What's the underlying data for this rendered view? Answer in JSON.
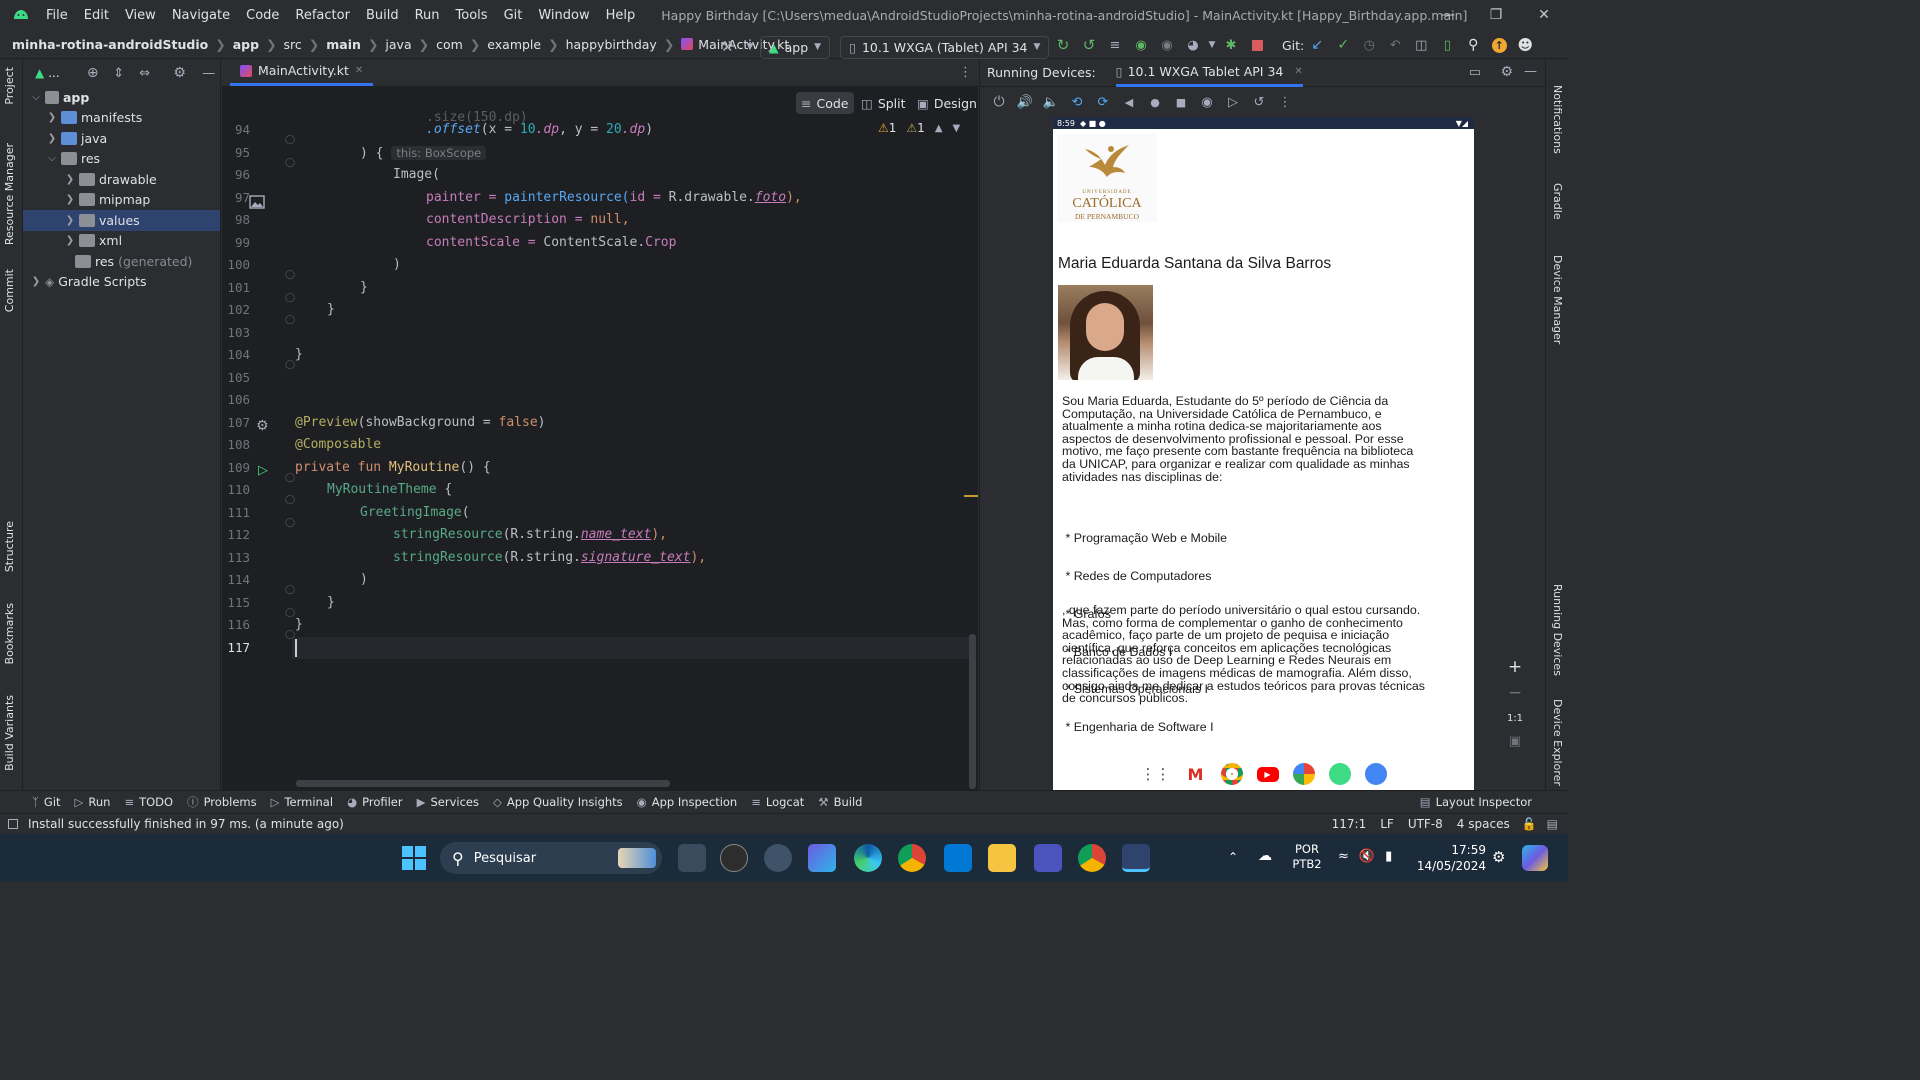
{
  "titlebar": {
    "menu": [
      "File",
      "Edit",
      "View",
      "Navigate",
      "Code",
      "Refactor",
      "Build",
      "Run",
      "Tools",
      "Git",
      "Window",
      "Help"
    ],
    "window_title": "Happy Birthday [C:\\Users\\medua\\AndroidStudioProjects\\minha-rotina-androidStudio] - MainActivity.kt [Happy_Birthday.app.main]"
  },
  "navbar": {
    "breadcrumbs": [
      "minha-rotina-androidStudio",
      "app",
      "src",
      "main",
      "java",
      "com",
      "example",
      "happybirthday",
      "MainActivity.kt"
    ],
    "run_config": "app",
    "device": "10.1  WXGA (Tablet) API 34",
    "git_label": "Git:"
  },
  "left_strip": {
    "labels": [
      "Project",
      "Resource Manager",
      "Commit",
      "Structure",
      "Bookmarks",
      "Build Variants"
    ]
  },
  "right_strip": {
    "labels": [
      "Notifications",
      "Gradle",
      "Device Manager",
      "Running Devices",
      "Device Explorer"
    ]
  },
  "project_tree": {
    "panel_label": "...",
    "items": [
      {
        "label": "app",
        "level": 0,
        "expanded": true
      },
      {
        "label": "manifests",
        "level": 1,
        "expanded": false
      },
      {
        "label": "java",
        "level": 1,
        "expanded": false
      },
      {
        "label": "res",
        "level": 1,
        "expanded": true
      },
      {
        "label": "drawable",
        "level": 2,
        "expanded": false
      },
      {
        "label": "mipmap",
        "level": 2,
        "expanded": false
      },
      {
        "label": "values",
        "level": 2,
        "expanded": false,
        "selected": true
      },
      {
        "label": "xml",
        "level": 2,
        "expanded": false
      },
      {
        "label": "res",
        "suffix": "(generated)",
        "level": 1
      },
      {
        "label": "Gradle Scripts",
        "level": 0,
        "expanded": false
      }
    ]
  },
  "editor": {
    "tab": "MainActivity.kt",
    "modes": [
      "Code",
      "Split",
      "Design"
    ],
    "warnings": [
      "1",
      "1"
    ],
    "line_numbers": [
      "94",
      "95",
      "96",
      "97",
      "98",
      "99",
      "100",
      "101",
      "102",
      "103",
      "104",
      "105",
      "106",
      "107",
      "108",
      "109",
      "110",
      "111",
      "112",
      "113",
      "114",
      "115",
      "116",
      "117"
    ],
    "inlay_hint": "this: BoxScope",
    "lines": {
      "l94_a": ".offset",
      "l94_b": "(x = ",
      "l94_c": "10",
      "l94_d": ".dp",
      "l94_e": ", y = ",
      "l94_f": "20",
      "l94_g": ".dp",
      "l94_h": ")",
      "l95": ") {",
      "l96": "Image(",
      "l97_a": "painter = ",
      "l97_b": "painterResource(",
      "l97_c": "id = ",
      "l97_d": "R.drawable.",
      "l97_e": "foto",
      "l97_f": "),",
      "l98_a": "contentDescription = ",
      "l98_b": "null",
      "l98_c": ",",
      "l99_a": "contentScale = ",
      "l99_b": "ContentScale.",
      "l99_c": "Crop",
      "l100": ")",
      "l101": "}",
      "l102": "}",
      "l104": "}",
      "l107_a": "@Preview",
      "l107_b": "(showBackground = ",
      "l107_c": "false",
      "l107_d": ")",
      "l108": "@Composable",
      "l109_a": "private fun ",
      "l109_b": "MyRoutine",
      "l109_c": "() {",
      "l110_a": "MyRoutineTheme",
      "l110_b": " {",
      "l111_a": "GreetingImage",
      "l111_b": "(",
      "l112_a": "stringResource",
      "l112_b": "(R.string.",
      "l112_c": "name_text",
      "l112_d": "),",
      "l113_a": "stringResource",
      "l113_b": "(R.string.",
      "l113_c": "signature_text",
      "l113_d": "),",
      "l114": ")",
      "l115": "}",
      "l116": "}"
    }
  },
  "running_devices": {
    "label": "Running Devices:",
    "tab": "10.1 WXGA Tablet API 34",
    "status_time": "8:59",
    "logo_lines": [
      "UNIVERSIDADE",
      "CATÓLICA",
      "DE PERNAMBUCO"
    ],
    "name": "Maria Eduarda Santana da Silva Barros",
    "bio_lines": [
      "Sou Maria Eduarda, Estudante do 5º período de Ciência da",
      "Computação, na Universidade Católica de Pernambuco, e",
      "atualmente a minha rotina dedica-se majoritariamente aos",
      "aspectos de desenvolvimento profissional e pessoal. Por esse",
      "motivo, me faço presente com bastante frequência na biblioteca",
      "da UNICAP, para organizar e realizar com qualidade as minhas",
      "atividades nas disciplinas de:"
    ],
    "subjects": [
      " * Programação Web e Mobile",
      " * Redes de Computadores",
      " * Grafos",
      " * Banco de Dados I",
      " * Sistemas Operacionais I",
      " * Engenharia de Software I"
    ],
    "closing_lines": [
      ", que fazem parte do período universitário o qual estou cursando.",
      "Mas, como forma de complementar o ganho de conhecimento",
      "acadêmico, faço parte de um projeto de pequisa e iniciação",
      "científica, que reforça conceitos em aplicações tecnológicas",
      "relacionadas ao uso de Deep Learning e Redes Neurais em",
      "classificações de imagens médicas de mamografia. Além disso,",
      "consigo ainda me dedicar a estudos teóricos para provas técnicas",
      "de concursos públicos."
    ],
    "zoom_label": "1:1"
  },
  "tool_windows": [
    "Git",
    "Run",
    "TODO",
    "Problems",
    "Terminal",
    "Profiler",
    "Services",
    "App Quality Insights",
    "App Inspection",
    "Logcat",
    "Build"
  ],
  "layout_inspector": "Layout Inspector",
  "status": {
    "message": "Install successfully finished in 97 ms. (a minute ago)",
    "position": "117:1",
    "line_sep": "LF",
    "encoding": "UTF-8",
    "indent": "4 spaces"
  },
  "taskbar": {
    "search": "Pesquisar",
    "lang1": "POR",
    "lang2": "PTB2",
    "time": "17:59",
    "date": "14/05/2024"
  },
  "colors": {
    "accent": "#3574f0",
    "editor_bg": "#1e1f22",
    "panel_bg": "#2b2d30",
    "selection": "#2e436e",
    "android_green": "#3ddc84"
  }
}
